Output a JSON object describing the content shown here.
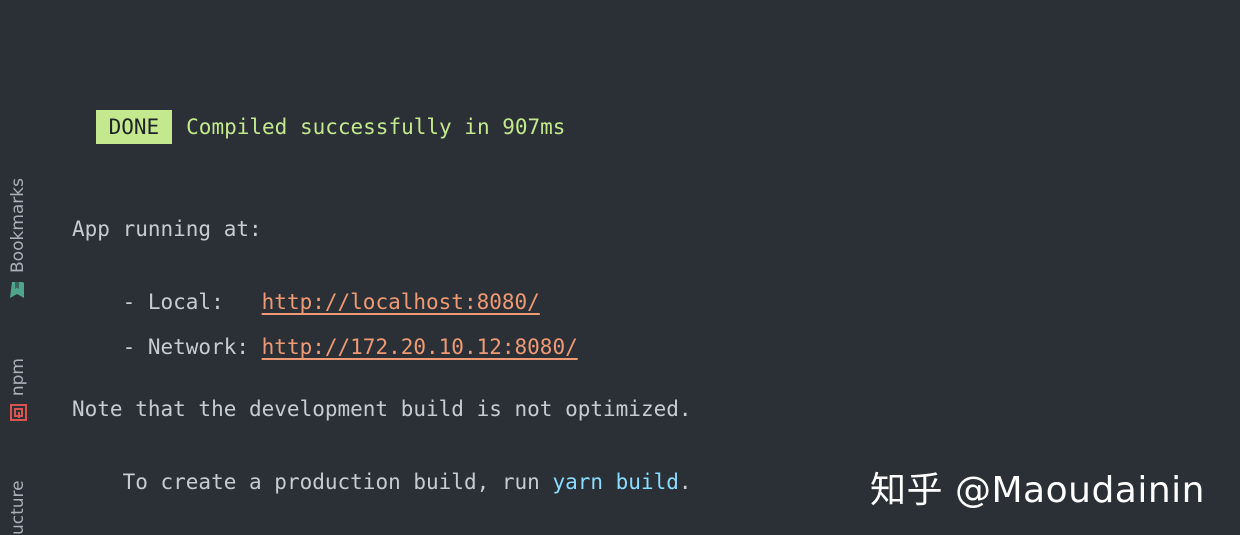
{
  "sidebar": {
    "tabs": [
      {
        "label": "Bookmarks",
        "icon": "bookmark-icon",
        "color": "#4fa58a"
      },
      {
        "label": "npm",
        "icon": "npm-icon",
        "color": "#d9534f"
      },
      {
        "label": "ucture",
        "icon": "structure-icon"
      }
    ]
  },
  "terminal": {
    "status": {
      "badge": "DONE",
      "message": "Compiled successfully in 907ms",
      "color": "#c3e88d"
    },
    "app_running": "App running at:",
    "local": {
      "label": "- Local:   ",
      "url": "http://localhost:8080/"
    },
    "network": {
      "label": "- Network: ",
      "url": "http://172.20.10.12:8080/"
    },
    "note": "Note that the development build is not optimized.",
    "production": {
      "prefix": "To create a production build, run ",
      "command": "yarn build",
      "suffix": "."
    }
  },
  "watermark": "知乎 @Maoudainin",
  "colors": {
    "background": "#2b3036",
    "text": "#c7ccd1",
    "link": "#ef9a74",
    "command": "#89ddff"
  }
}
